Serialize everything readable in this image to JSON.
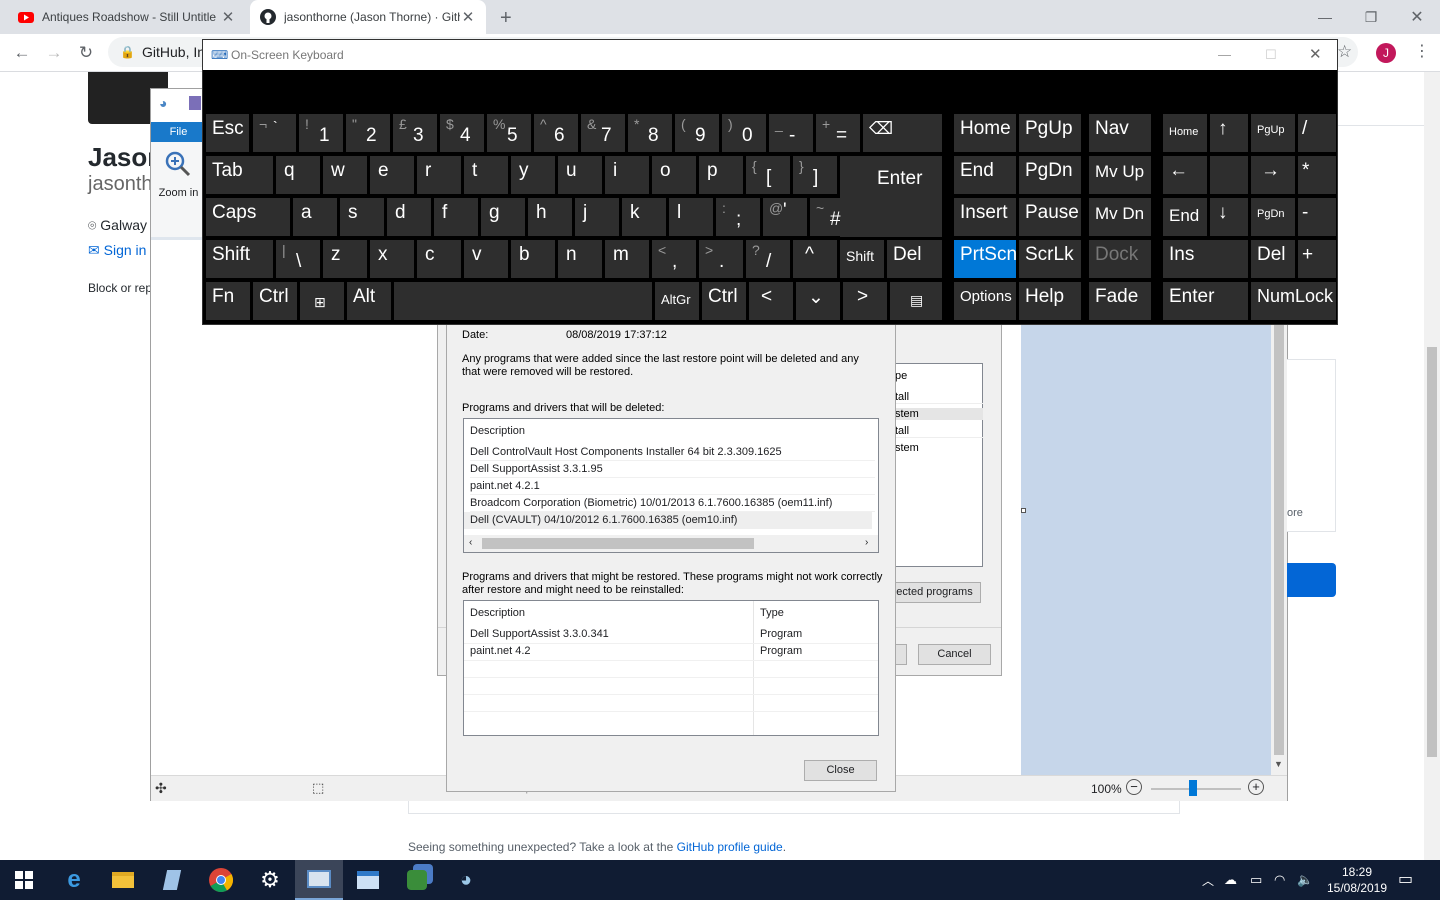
{
  "tabs": [
    {
      "title": "Antiques Roadshow - Still Untitle"
    },
    {
      "title": "jasonthorne (Jason Thorne) · Gith"
    }
  ],
  "omnibox": {
    "text": "GitHub, In"
  },
  "profile_initial": "J",
  "github": {
    "name": "Jason",
    "username": "jasonth",
    "location": "Galway",
    "signin": "Sign in",
    "block": "Block or rep",
    "footer_prefix": "Seeing something unexpected? Take a look at the",
    "footer_link": "GitHub profile guide",
    "footer_suffix": "."
  },
  "paint": {
    "file_tab": "File",
    "zoom_in": "Zoom in",
    "zoom_level": "100%",
    "right_text": "ore",
    "clipped_size": "··· × ···px"
  },
  "osk": {
    "title": "On-Screen Keyboard"
  },
  "restore_main": {
    "partial_col": "pe",
    "partial_rows": [
      "tall",
      "stem",
      "tall",
      "stem"
    ],
    "detect_button": "ected programs",
    "cancel": "Cancel"
  },
  "affected": {
    "date_label": "Date:",
    "date_value": "08/08/2019 17:37:12",
    "intro": "Any programs that were added since the last restore point will be deleted and any that were removed will be restored.",
    "deleted_heading": "Programs and drivers that will be deleted:",
    "deleted_col": "Description",
    "deleted_rows": [
      "Dell ControlVault Host Components Installer 64 bit 2.3.309.1625",
      "Dell SupportAssist 3.3.1.95",
      "paint.net 4.2.1",
      "Broadcom Corporation (Biometric) 10/01/2013 6.1.7600.16385 (oem11.inf)",
      "Dell (CVAULT) 04/10/2012 6.1.7600.16385 (oem10.inf)"
    ],
    "restored_heading": "Programs and drivers that might be restored. These programs might not work correctly after restore and might need to be reinstalled:",
    "restored_cols": [
      "Description",
      "Type"
    ],
    "restored_rows": [
      {
        "desc": "Dell SupportAssist 3.3.0.341",
        "type": "Program"
      },
      {
        "desc": "paint.net 4.2",
        "type": "Program"
      }
    ],
    "close": "Close"
  },
  "taskbar": {
    "time": "18:29",
    "date": "15/08/2019"
  },
  "colors": {
    "accent": "#0078d7",
    "taskbar": "#101c33",
    "osk_key": "#2e2e2e",
    "github_link": "#0366d6"
  }
}
